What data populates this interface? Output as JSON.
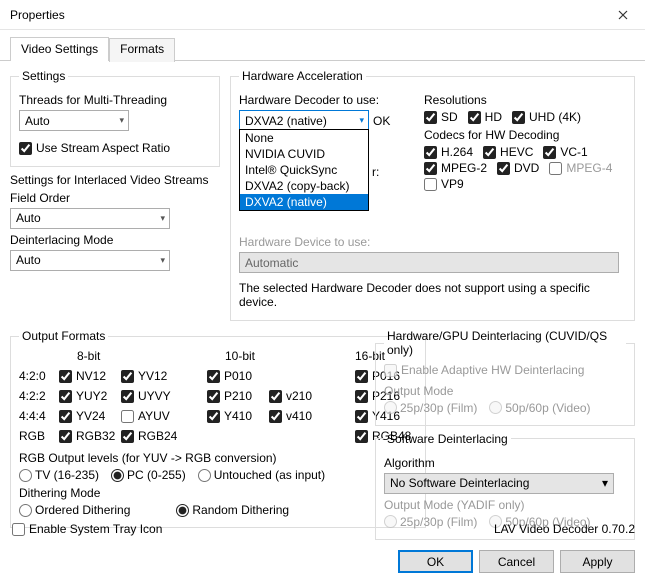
{
  "window": {
    "title": "Properties"
  },
  "tabs": {
    "active": "Video Settings",
    "inactive": "Formats"
  },
  "settings": {
    "legend": "Settings",
    "threads_label": "Threads for Multi-Threading",
    "threads_value": "Auto",
    "stream_ar_label": "Use Stream Aspect Ratio",
    "interlaced_label": "Settings for Interlaced Video Streams",
    "field_order_label": "Field Order",
    "field_order_value": "Auto",
    "deint_mode_label": "Deinterlacing Mode",
    "deint_mode_value": "Auto"
  },
  "hw": {
    "legend": "Hardware Acceleration",
    "decoder_label": "Hardware Decoder to use:",
    "decoder_value": "DXVA2 (native)",
    "ok_label": "OK",
    "options": [
      "None",
      "NVIDIA CUVID",
      "Intel® QuickSync",
      "DXVA2 (copy-back)",
      "DXVA2 (native)"
    ],
    "obscured_label_tail": "r:",
    "device_label": "Hardware Device to use:",
    "device_value": "Automatic",
    "note": "The selected Hardware Decoder does not support using a specific device.",
    "res_label": "Resolutions",
    "res": {
      "sd": "SD",
      "hd": "HD",
      "uhd": "UHD (4K)"
    },
    "codecs_label": "Codecs for HW Decoding",
    "codecs": {
      "h264": "H.264",
      "hevc": "HEVC",
      "vc1": "VC-1",
      "mpeg2": "MPEG-2",
      "dvd": "DVD",
      "mpeg4": "MPEG-4",
      "vp9": "VP9"
    }
  },
  "of": {
    "legend": "Output Formats",
    "h8": "8-bit",
    "h10": "10-bit",
    "h16": "16-bit",
    "r420": "4:2:0",
    "r422": "4:2:2",
    "r444": "4:4:4",
    "rrgb": "RGB",
    "nv12": "NV12",
    "yv12": "YV12",
    "p010": "P010",
    "p016": "P016",
    "yuy2": "YUY2",
    "uyvy": "UYVY",
    "p210": "P210",
    "v210": "v210",
    "p216": "P216",
    "yv24": "YV24",
    "ayuv": "AYUV",
    "y410": "Y410",
    "v410": "v410",
    "y416": "Y416",
    "rgb32": "RGB32",
    "rgb24": "RGB24",
    "rgb48": "RGB48",
    "rgb_levels_label": "RGB Output levels (for YUV -> RGB conversion)",
    "rgb_tv": "TV (16-235)",
    "rgb_pc": "PC (0-255)",
    "rgb_untouched": "Untouched (as input)",
    "dither_label": "Dithering Mode",
    "dither_ordered": "Ordered Dithering",
    "dither_random": "Random Dithering"
  },
  "gpu_deint": {
    "legend": "Hardware/GPU Deinterlacing (CUVID/QS only)",
    "adaptive": "Enable Adaptive HW Deinterlacing",
    "output_mode": "Output Mode",
    "r25": "25p/30p (Film)",
    "r50": "50p/60p (Video)"
  },
  "sw_deint": {
    "legend": "Software Deinterlacing",
    "algo_label": "Algorithm",
    "algo_value": "No Software Deinterlacing",
    "output_mode": "Output Mode (YADIF only)",
    "r25": "25p/30p (Film)",
    "r50": "50p/60p (Video)"
  },
  "footer": {
    "tray": "Enable System Tray Icon",
    "version": "LAV Video Decoder 0.70.2",
    "ok": "OK",
    "cancel": "Cancel",
    "apply": "Apply"
  }
}
